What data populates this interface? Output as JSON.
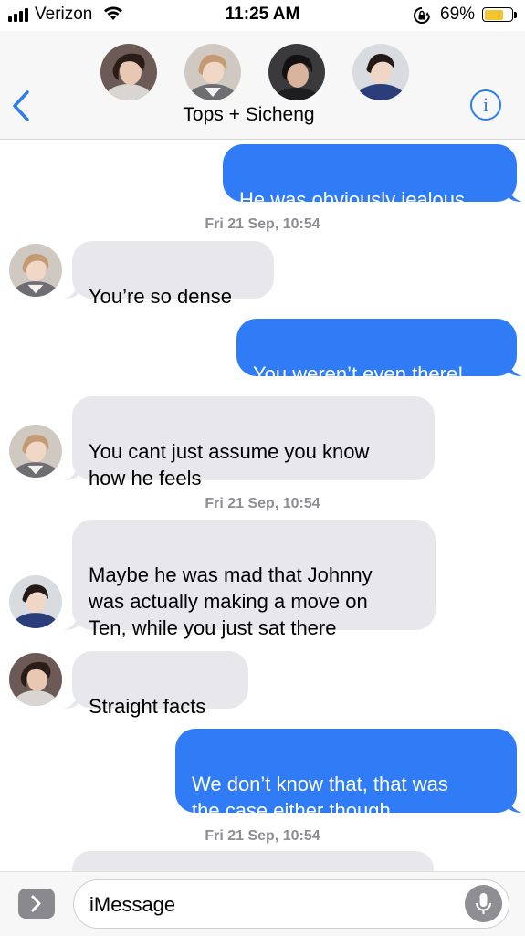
{
  "status_bar": {
    "carrier": "Verizon",
    "time": "11:25 AM",
    "battery_percent": "69%",
    "battery_level": 0.69,
    "icons": [
      "signal-bars-icon",
      "wifi-icon",
      "rotation-lock-icon",
      "battery-icon"
    ]
  },
  "header": {
    "group_name": "Tops + Sicheng",
    "back_icon": "chevron-left-icon",
    "info_icon": "info-icon",
    "info_glyph": "i"
  },
  "messages": [
    {
      "type": "sent",
      "text": "He was obviously jealous"
    },
    {
      "type": "timestamp",
      "text": "Fri 21 Sep, 10:54"
    },
    {
      "type": "received",
      "sender_avatar": "avatar-b",
      "text": "You’re so dense"
    },
    {
      "type": "sent",
      "text": "You weren’t even there!"
    },
    {
      "type": "received",
      "sender_avatar": "avatar-b",
      "text": "You cant just assume you know\nhow he feels"
    },
    {
      "type": "timestamp",
      "text": "Fri 21 Sep, 10:54"
    },
    {
      "type": "received",
      "sender_avatar": "avatar-d",
      "text": "Maybe he was mad that Johnny\nwas actually making a move on\nTen, while you just sat there"
    },
    {
      "type": "received",
      "sender_avatar": "avatar-a",
      "text": "Straight facts"
    },
    {
      "type": "sent",
      "text": "We don’t know that, that was\nthe case either though"
    },
    {
      "type": "timestamp",
      "text": "Fri 21 Sep, 10:54"
    }
  ],
  "input_bar": {
    "placeholder": "iMessage",
    "apps_icon": "chevron-right-icon",
    "mic_icon": "microphone-icon"
  },
  "colors": {
    "sent_bubble": "#2f7cf6",
    "received_bubble": "#e7e7ec",
    "accent": "#2a7cf0",
    "timestamp": "#8e8e93"
  }
}
